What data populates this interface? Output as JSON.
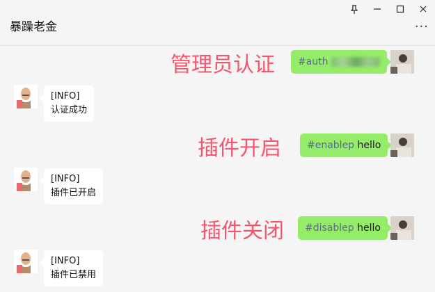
{
  "window": {
    "title": "暴躁老金",
    "controls": [
      "pin-icon",
      "minimize-icon",
      "maximize-icon",
      "close-icon"
    ],
    "more_label": "···"
  },
  "messages": [
    {
      "side": "right",
      "annotation": "管理员认证",
      "text": "#auth",
      "text_tail": "",
      "redacted": true
    },
    {
      "side": "left",
      "lines": [
        "[INFO]",
        "认证成功"
      ]
    },
    {
      "side": "right",
      "annotation": "插件开启",
      "text": "#enablep",
      "text_tail": "hello"
    },
    {
      "side": "left",
      "lines": [
        "[INFO]",
        "插件已开启"
      ]
    },
    {
      "side": "right",
      "annotation": "插件关闭",
      "text": "#disablep",
      "text_tail": "hello"
    },
    {
      "side": "left",
      "lines": [
        "[INFO]",
        "插件已禁用"
      ]
    }
  ],
  "colors": {
    "outgoing_bubble": "#95ec69",
    "incoming_bubble": "#ffffff",
    "annotation": "#f4566e",
    "background": "#f5f5f5"
  }
}
